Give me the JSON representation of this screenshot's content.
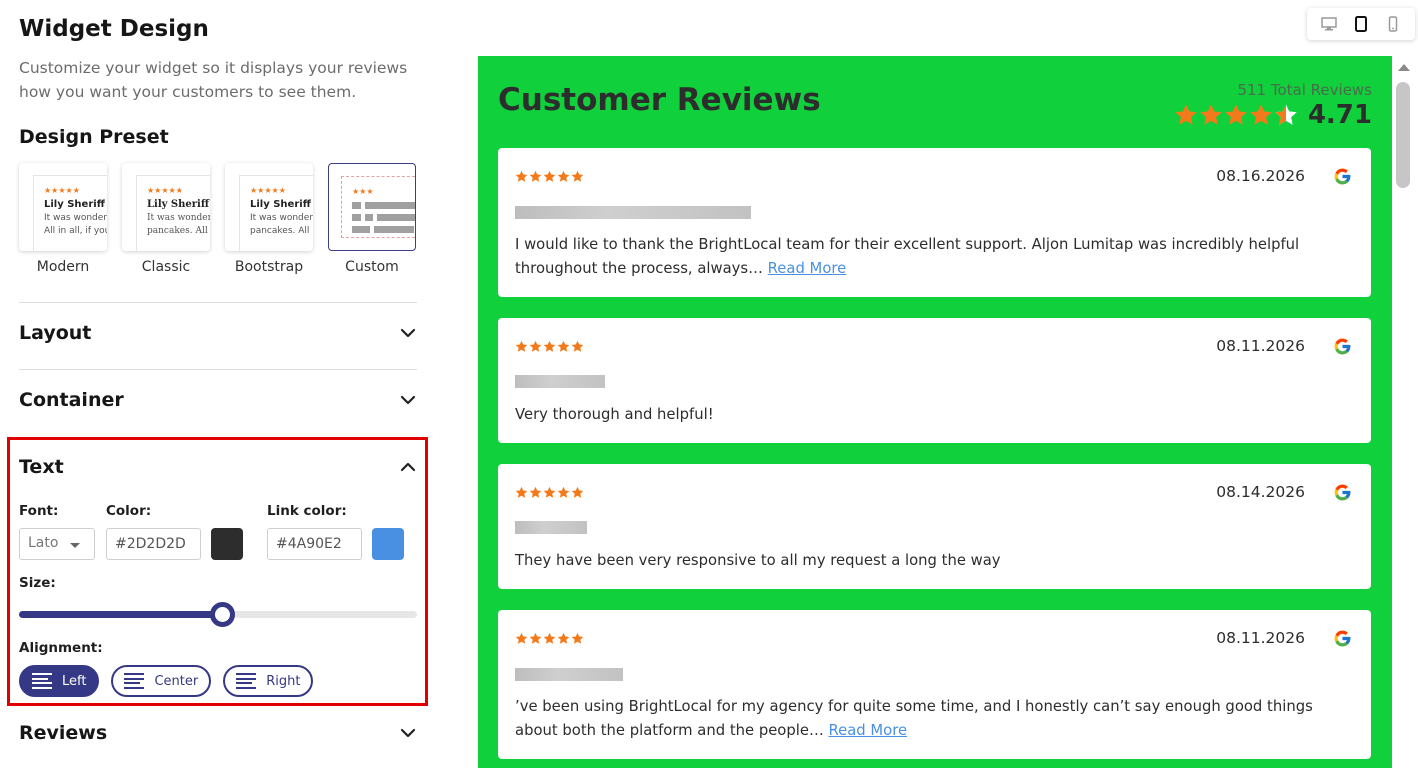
{
  "header": {
    "title": "Widget Design",
    "description": "Customize your widget so it displays your reviews how you want your customers to see them."
  },
  "design_preset": {
    "title": "Design Preset",
    "presets": [
      {
        "label": "Modern",
        "name": "Lily Sheriff",
        "line1": "It was wonder",
        "line2": "All in all, if you"
      },
      {
        "label": "Classic",
        "name": "Lily Sheriff",
        "line1": "It was wonder",
        "line2": "pancakes. All"
      },
      {
        "label": "Bootstrap",
        "name": "Lily Sheriff",
        "line1": "It was wonder",
        "line2": "pancakes. All"
      },
      {
        "label": "Custom",
        "selected": true
      }
    ],
    "thumb_stars": "★★★★★",
    "custom_stars": "★★★"
  },
  "sections": {
    "layout": "Layout",
    "container": "Container",
    "text": "Text",
    "reviews": "Reviews"
  },
  "text_settings": {
    "font_label": "Font:",
    "font_value": "Lato",
    "color_label": "Color:",
    "color_value": "#2D2D2D",
    "color_swatch": "#2d2d2d",
    "link_color_label": "Link color:",
    "link_color_value": "#4A90E2",
    "link_swatch": "#4a90e2",
    "size_label": "Size:",
    "size_level_percent": 51,
    "alignment_label": "Alignment:",
    "alignment_options": [
      "Left",
      "Center",
      "Right"
    ],
    "alignment_selected": "Left"
  },
  "device_switcher": [
    "desktop-icon",
    "tablet-icon",
    "mobile-icon"
  ],
  "preview": {
    "title": "Customer Reviews",
    "total_reviews": "511 Total Reviews",
    "rating": "4.71",
    "background": "#10d03c",
    "reviews": [
      {
        "date": "08.16.2026",
        "text": "I would like to thank the BrightLocal team for their excellent support. Aljon Lumitap was incredibly helpful throughout the process, always…",
        "read_more": "Read More"
      },
      {
        "date": "08.11.2026",
        "text": "Very thorough and helpful!"
      },
      {
        "date": "08.14.2026",
        "text": "They have been very responsive to all my request a long the way"
      },
      {
        "date": "08.11.2026",
        "text": "’ve been using BrightLocal for my agency for quite some time, and I honestly can’t say enough good things about both the platform and the people…",
        "read_more": "Read More"
      }
    ]
  },
  "colors": {
    "accent": "#353884",
    "star": "#f27a1a",
    "highlight_border": "#e00000"
  }
}
